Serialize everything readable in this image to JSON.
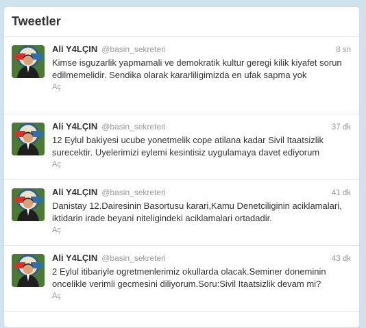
{
  "panel": {
    "title": "Tweetler"
  },
  "tweets": [
    {
      "name": "Ali Y4LÇIN",
      "handle": "@basin_sekreteri",
      "time": "8 sn",
      "text": "Kimse isguzarlik yapmamali ve demokratik kultur geregi kilik kiyafet sorun edilmemelidir. Sendika olarak kararliligimizda en ufak sapma yok",
      "action": "Aç"
    },
    {
      "name": "Ali Y4LÇIN",
      "handle": "@basin_sekreteri",
      "time": "37 dk",
      "text": "12 Eylul bakiyesi ucube yonetmelik cope atilana kadar Sivil Itaatsizlik surecektir. Uyelerimizi eylemi kesintisiz uygulamaya davet ediyorum",
      "action": "Aç"
    },
    {
      "name": "Ali Y4LÇIN",
      "handle": "@basin_sekreteri",
      "time": "41 dk",
      "text": "Danistay 12.Dairesinin Basortusu karari,Kamu Denetciliginin aciklamalari, iktidarin irade beyani niteligindeki aciklamalari ortadadir.",
      "action": "Aç"
    },
    {
      "name": "Ali Y4LÇIN",
      "handle": "@basin_sekreteri",
      "time": "43 dk",
      "text": "2 Eylul itibariyle ogretmenlerimiz okullarda olacak.Seminer doneminin oncelikle verimli gecmesini diliyorum.Soru:Sivil Itaatsizlik devam mi?",
      "action": "Aç"
    }
  ]
}
